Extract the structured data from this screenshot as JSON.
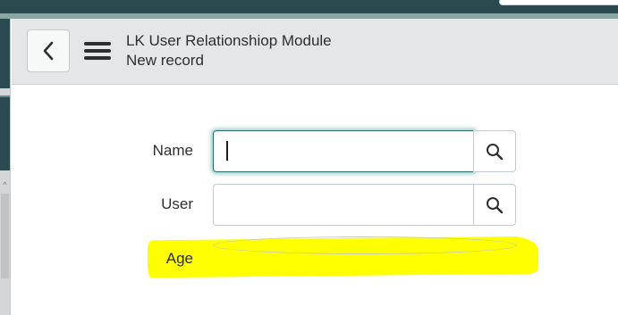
{
  "form": {
    "title": "LK User Relationshiop Module",
    "subtitle": "New record"
  },
  "fields": {
    "name": {
      "label": "Name",
      "value": ""
    },
    "user": {
      "label": "User",
      "value": ""
    },
    "age": {
      "label": "Age"
    }
  },
  "icons": {
    "back": "chevron-left-icon",
    "menu": "hamburger-menu-icon",
    "lookup": "magnifier-search-icon"
  },
  "colors": {
    "header_dark": "#2b4a4f",
    "focus_border": "#2b6f6a",
    "highlight": "#ffff00"
  }
}
